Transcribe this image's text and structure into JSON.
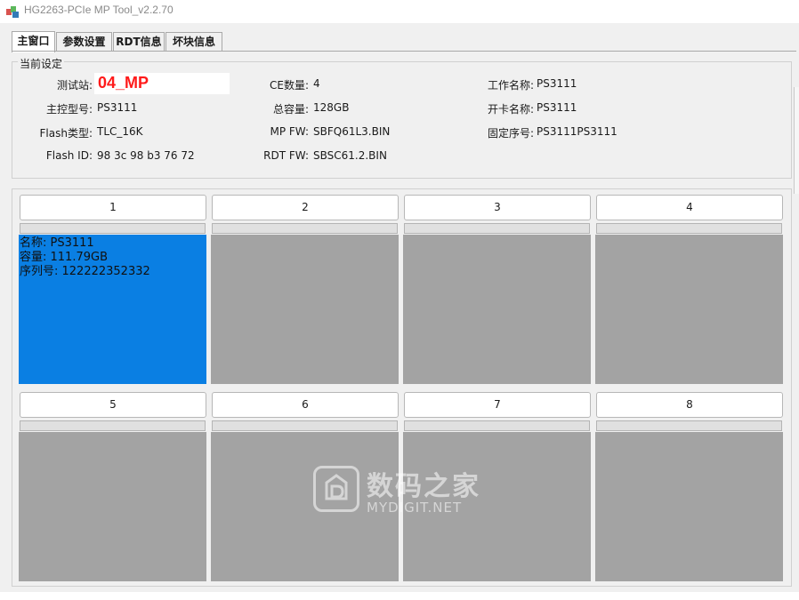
{
  "window": {
    "title": "HG2263-PCIe MP Tool_v2.2.70"
  },
  "tabs": [
    {
      "label": "主窗口"
    },
    {
      "label": "参数设置"
    },
    {
      "label": "RDT信息"
    },
    {
      "label": "坏块信息"
    }
  ],
  "settings": {
    "title": "当前设定",
    "station_label": "测试站:",
    "station_value": "04_MP",
    "controller_label": "主控型号:",
    "controller_value": "PS3111",
    "flash_type_label": "Flash类型:",
    "flash_type_value": "TLC_16K",
    "flash_id_label": "Flash ID:",
    "flash_id_value": "98 3c 98 b3 76 72",
    "ce_label": "CE数量:",
    "ce_value": "4",
    "capacity_label": "总容量:",
    "capacity_value": "128GB",
    "mp_fw_label": "MP FW:",
    "mp_fw_value": "SBFQ61L3.BIN",
    "rdt_fw_label": "RDT FW:",
    "rdt_fw_value": "SBSC61.2.BIN",
    "work_name_label": "工作名称:",
    "work_name_value": "PS3111",
    "card_name_label": "开卡名称:",
    "card_name_value": "PS3111",
    "serial_label": "固定序号:",
    "serial_value": "PS3111PS3111"
  },
  "ports": [
    {
      "number": "1",
      "active": true,
      "name_line": "名称: PS3111",
      "capacity_line": "容量: 111.79GB",
      "serial_line": "序列号: 122222352332"
    },
    {
      "number": "2",
      "active": false
    },
    {
      "number": "3",
      "active": false
    },
    {
      "number": "4",
      "active": false
    },
    {
      "number": "5",
      "active": false
    },
    {
      "number": "6",
      "active": false
    },
    {
      "number": "7",
      "active": false
    },
    {
      "number": "8",
      "active": false
    }
  ],
  "watermark": {
    "text": "数码之家",
    "sub": "MYDIGIT.NET"
  },
  "colors": {
    "active_port": "#0a7fe3",
    "idle_port": "#a3a3a3",
    "station_text": "#ff1a1a"
  }
}
